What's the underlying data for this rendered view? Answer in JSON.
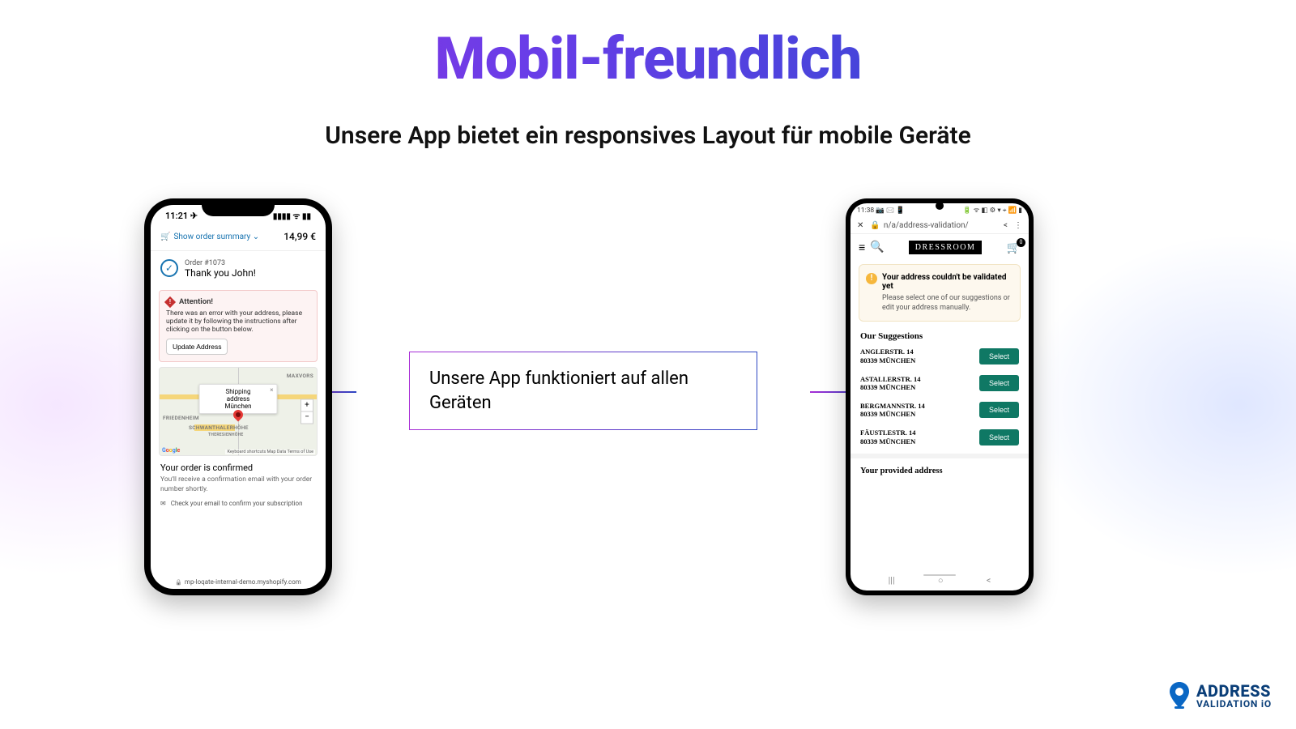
{
  "headline": "Mobil-freundlich",
  "subhead": "Unsere App bietet ein responsives Layout für mobile Geräte",
  "callout": "Unsere App funktioniert auf allen Geräten",
  "iphone": {
    "time": "11:21 ✈",
    "signal": "▮▮▮▮ ᯤ ▮▮",
    "summary_toggle": "Show order summary ⌄",
    "price": "14,99 €",
    "order_no": "Order #1073",
    "thank": "Thank you John!",
    "alert_title": "Attention!",
    "alert_body": "There was an error with your address, please update it by following the instructions after clicking on the button below.",
    "alert_btn": "Update Address",
    "map_popup_title": "Shipping address",
    "map_popup_city": "München",
    "map_l1": "MAXVORS",
    "map_l2": "FRIEDENHEIM",
    "map_l3": "SCHWANTHALERHÖHE",
    "map_l4": "THERESIENHÖHE",
    "map_foot": "Keyboard shortcuts   Map Data   Terms of Use",
    "conf_h": "Your order is confirmed",
    "conf_p": "You'll receive a confirmation email with your order number shortly.",
    "mail_line": "Check your email to confirm your subscription",
    "url": "mp-loqate-internal-demo.myshopify.com"
  },
  "android": {
    "time": "11:38 📷 🖂 📱",
    "status_r": "🔋 ᯤ ◧ ⚙ ▾ ⌖ 📶 ▮",
    "close": "✕",
    "lock": "🔒",
    "addr": "n/a/address-validation/",
    "share": "<",
    "more": "⋮",
    "menu": "≡",
    "search": "🔍",
    "logo": "DRESSROOM",
    "cart_count": "0",
    "warn_h": "Your address couldn't be validated yet",
    "warn_p": "Please select one of our suggestions or edit your address manually.",
    "sugg_h": "Our Suggestions",
    "select": "Select",
    "suggestions": [
      {
        "l1": "ANGLERSTR. 14",
        "l2": "80339 MÜNCHEN"
      },
      {
        "l1": "ASTALLERSTR. 14",
        "l2": "80339 MÜNCHEN"
      },
      {
        "l1": "BERGMANNSTR. 14",
        "l2": "80339 MÜNCHEN"
      },
      {
        "l1": "FÄUSTLESTR. 14",
        "l2": "80339 MÜNCHEN"
      }
    ],
    "provided_h": "Your provided address",
    "nav_back": "|||",
    "nav_home": "○",
    "nav_recent": "<"
  },
  "brand": {
    "l1": "ADDRESS",
    "l2": "VALIDATION iO"
  }
}
